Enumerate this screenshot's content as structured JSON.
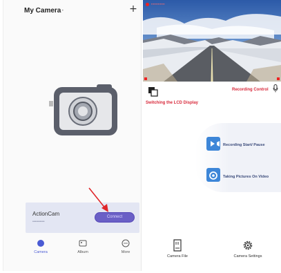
{
  "left_screen": {
    "header": {
      "title": "My Camera",
      "title_suffix": "•",
      "add_icon": "plus-icon"
    },
    "device_card": {
      "name": "ActionCam",
      "subtitle": "••••••••••",
      "connect_label": "Connect"
    },
    "tabs": [
      {
        "label": "Camera",
        "icon": "camera-dot-icon",
        "active": true
      },
      {
        "label": "Album",
        "icon": "album-icon",
        "active": false
      },
      {
        "label": "More",
        "icon": "more-icon",
        "active": false
      }
    ]
  },
  "right_screen": {
    "live_view": {
      "overlay_text": "▪▪▪▪▪▪▪▪▪▪▪▪▪▪"
    },
    "lcd": {
      "label": "Switching the LCD Display",
      "icon": "lcd-switch-icon"
    },
    "recording_control": {
      "label": "Recording Control",
      "icon": "microphone-icon"
    },
    "actions": [
      {
        "label": "Recording Start/ Pause",
        "icon": "video-camera-icon"
      },
      {
        "label": "Taking Pictures On Video",
        "icon": "snapshot-icon"
      }
    ],
    "bottom": [
      {
        "label": "Camera File",
        "icon": "sd-card-icon"
      },
      {
        "label": "Camera Settings",
        "icon": "gear-icon"
      }
    ]
  },
  "colors": {
    "accent_red": "#d8283a",
    "accent_blue": "#3d86d8",
    "connect_purple": "#6a5fc6",
    "active_tab": "#4a5bd4"
  }
}
